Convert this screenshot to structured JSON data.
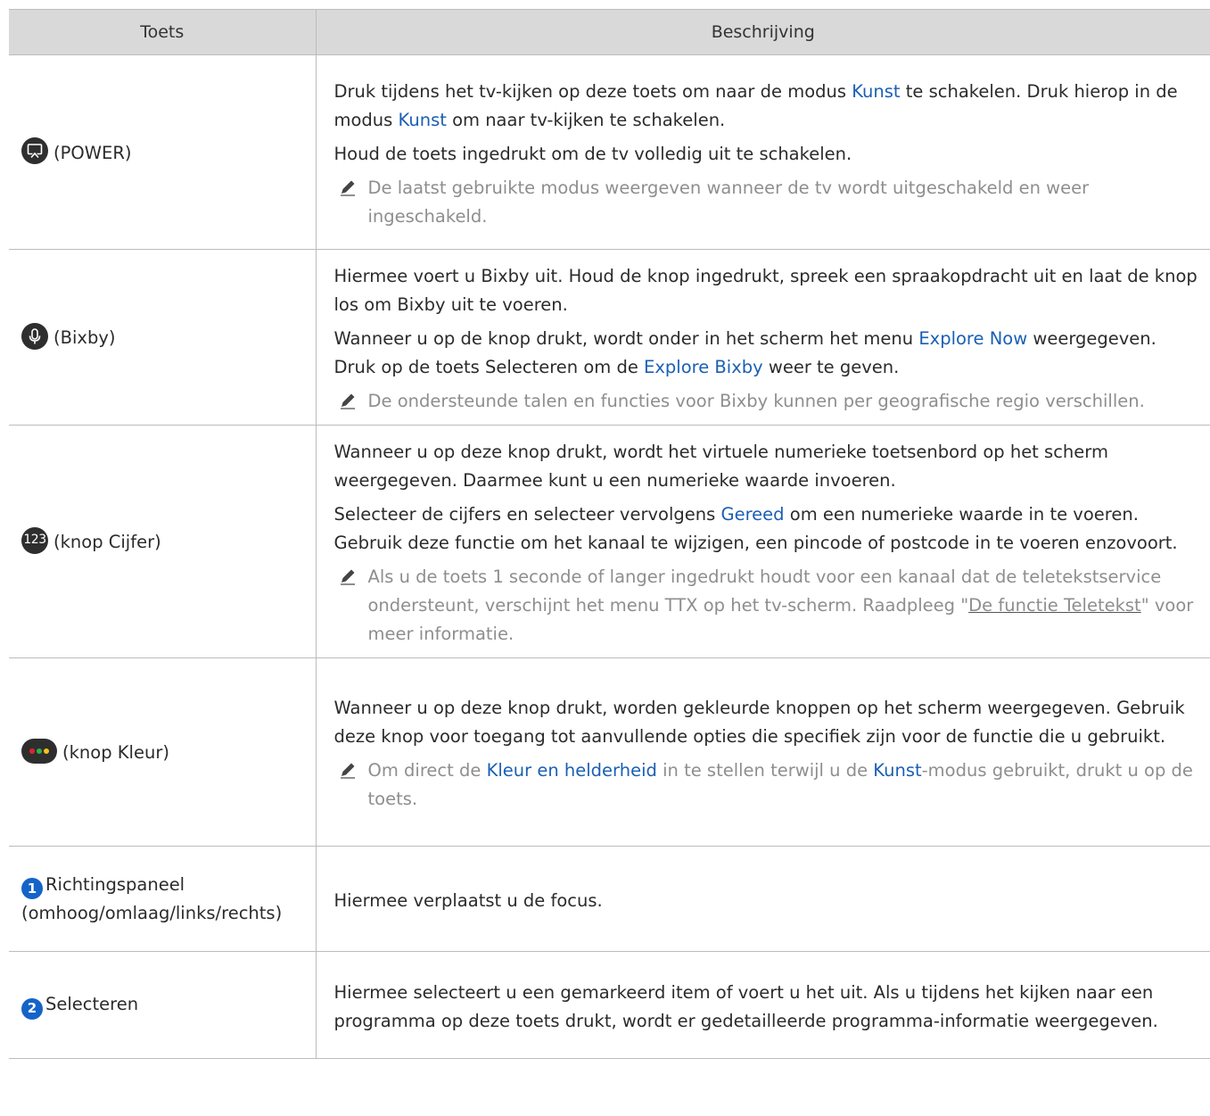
{
  "table": {
    "header": {
      "col1": "Toets",
      "col2": "Beschrijving"
    },
    "rows": {
      "power": {
        "key_label": "(POWER)",
        "icon": "art-mode-power-icon",
        "p1": [
          "Druk tijdens het tv-kijken op deze toets om naar de modus ",
          "Kunst",
          " te schakelen. Druk hierop in de modus ",
          "Kunst",
          " om naar tv-kijken te schakelen."
        ],
        "p2": "Houd de toets ingedrukt om de tv volledig uit te schakelen.",
        "note": "De laatst gebruikte modus weergeven wanneer de tv wordt uitgeschakeld en weer ingeschakeld."
      },
      "bixby": {
        "key_label": "(Bixby)",
        "icon": "microphone-icon",
        "p1": "Hiermee voert u Bixby uit. Houd de knop ingedrukt, spreek een spraakopdracht uit en laat de knop los om Bixby uit te voeren.",
        "p2": [
          "Wanneer u op de knop drukt, wordt onder in het scherm het menu ",
          "Explore Now",
          " weergegeven. Druk op de toets Selecteren om de ",
          "Explore Bixby",
          " weer te geven."
        ],
        "note": "De ondersteunde talen en functies voor Bixby kunnen per geografische regio verschillen."
      },
      "number": {
        "key_label": "(knop Cijfer)",
        "icon_text": "123",
        "p1": "Wanneer u op deze knop drukt, wordt het virtuele numerieke toetsenbord op het scherm weergegeven. Daarmee kunt u een numerieke waarde invoeren.",
        "p2": [
          "Selecteer de cijfers en selecteer vervolgens ",
          "Gereed",
          " om een numerieke waarde in te voeren. Gebruik deze functie om het kanaal te wijzigen, een pincode of postcode in te voeren enzovoort."
        ],
        "note": [
          "Als u de toets 1 seconde of langer ingedrukt houdt voor een kanaal dat de teletekstservice ondersteunt, verschijnt het menu TTX op het tv-scherm. Raadpleeg \"",
          "De functie Teletekst",
          "\" voor meer informatie."
        ]
      },
      "color": {
        "key_label": "(knop Kleur)",
        "icon": "color-buttons-icon",
        "colors": [
          "#e0242a",
          "#2fb34a",
          "#f3c316"
        ],
        "p1": "Wanneer u op deze knop drukt, worden gekleurde knoppen op het scherm weergegeven. Gebruik deze knop voor toegang tot aanvullende opties die specifiek zijn voor de functie die u gebruikt.",
        "note": [
          "Om direct de ",
          "Kleur en helderheid",
          " in te stellen terwijl u de ",
          "Kunst",
          "-modus gebruikt, drukt u op de toets."
        ]
      },
      "direction": {
        "badge": "1",
        "key_label": "Richtingspaneel (omhoog/omlaag/links/rechts)",
        "p1": "Hiermee verplaatst u de focus."
      },
      "select": {
        "badge": "2",
        "key_label": "Selecteren",
        "p1": "Hiermee selecteert u een gemarkeerd item of voert u het uit. Als u tijdens het kijken naar een programma op deze toets drukt, wordt er gedetailleerde programma-informatie weergegeven."
      }
    }
  }
}
